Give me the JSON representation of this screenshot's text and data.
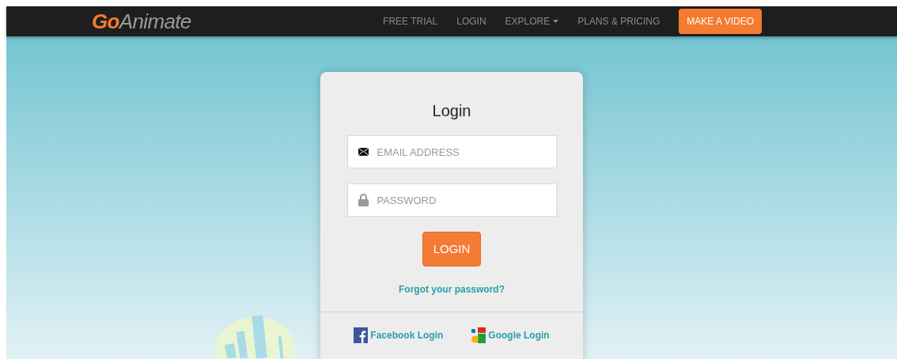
{
  "nav": {
    "logo": "**Go**Animate",
    "links": [
      {
        "label": "FREE TRIAL",
        "dropdown": false
      },
      {
        "label": "LOGIN",
        "dropdown": false
      },
      {
        "label": "EXPLORE",
        "dropdown": true
      },
      {
        "label": "PLANS & PRICING",
        "dropdown": false
      }
    ],
    "cta": "MAKE A VIDEO"
  },
  "login_card": {
    "title": "Login",
    "email": {
      "placeholder": "EMAIL ADDRESS"
    },
    "password": {
      "placeholder": "PASSWORD"
    },
    "submit": "LOGIN",
    "forgot_link": "Forgot your password?",
    "social": [
      {
        "kind": "facebook",
        "label": "Facebook Login"
      },
      {
        "kind": "google",
        "label": "Google Login"
      }
    ]
  }
}
